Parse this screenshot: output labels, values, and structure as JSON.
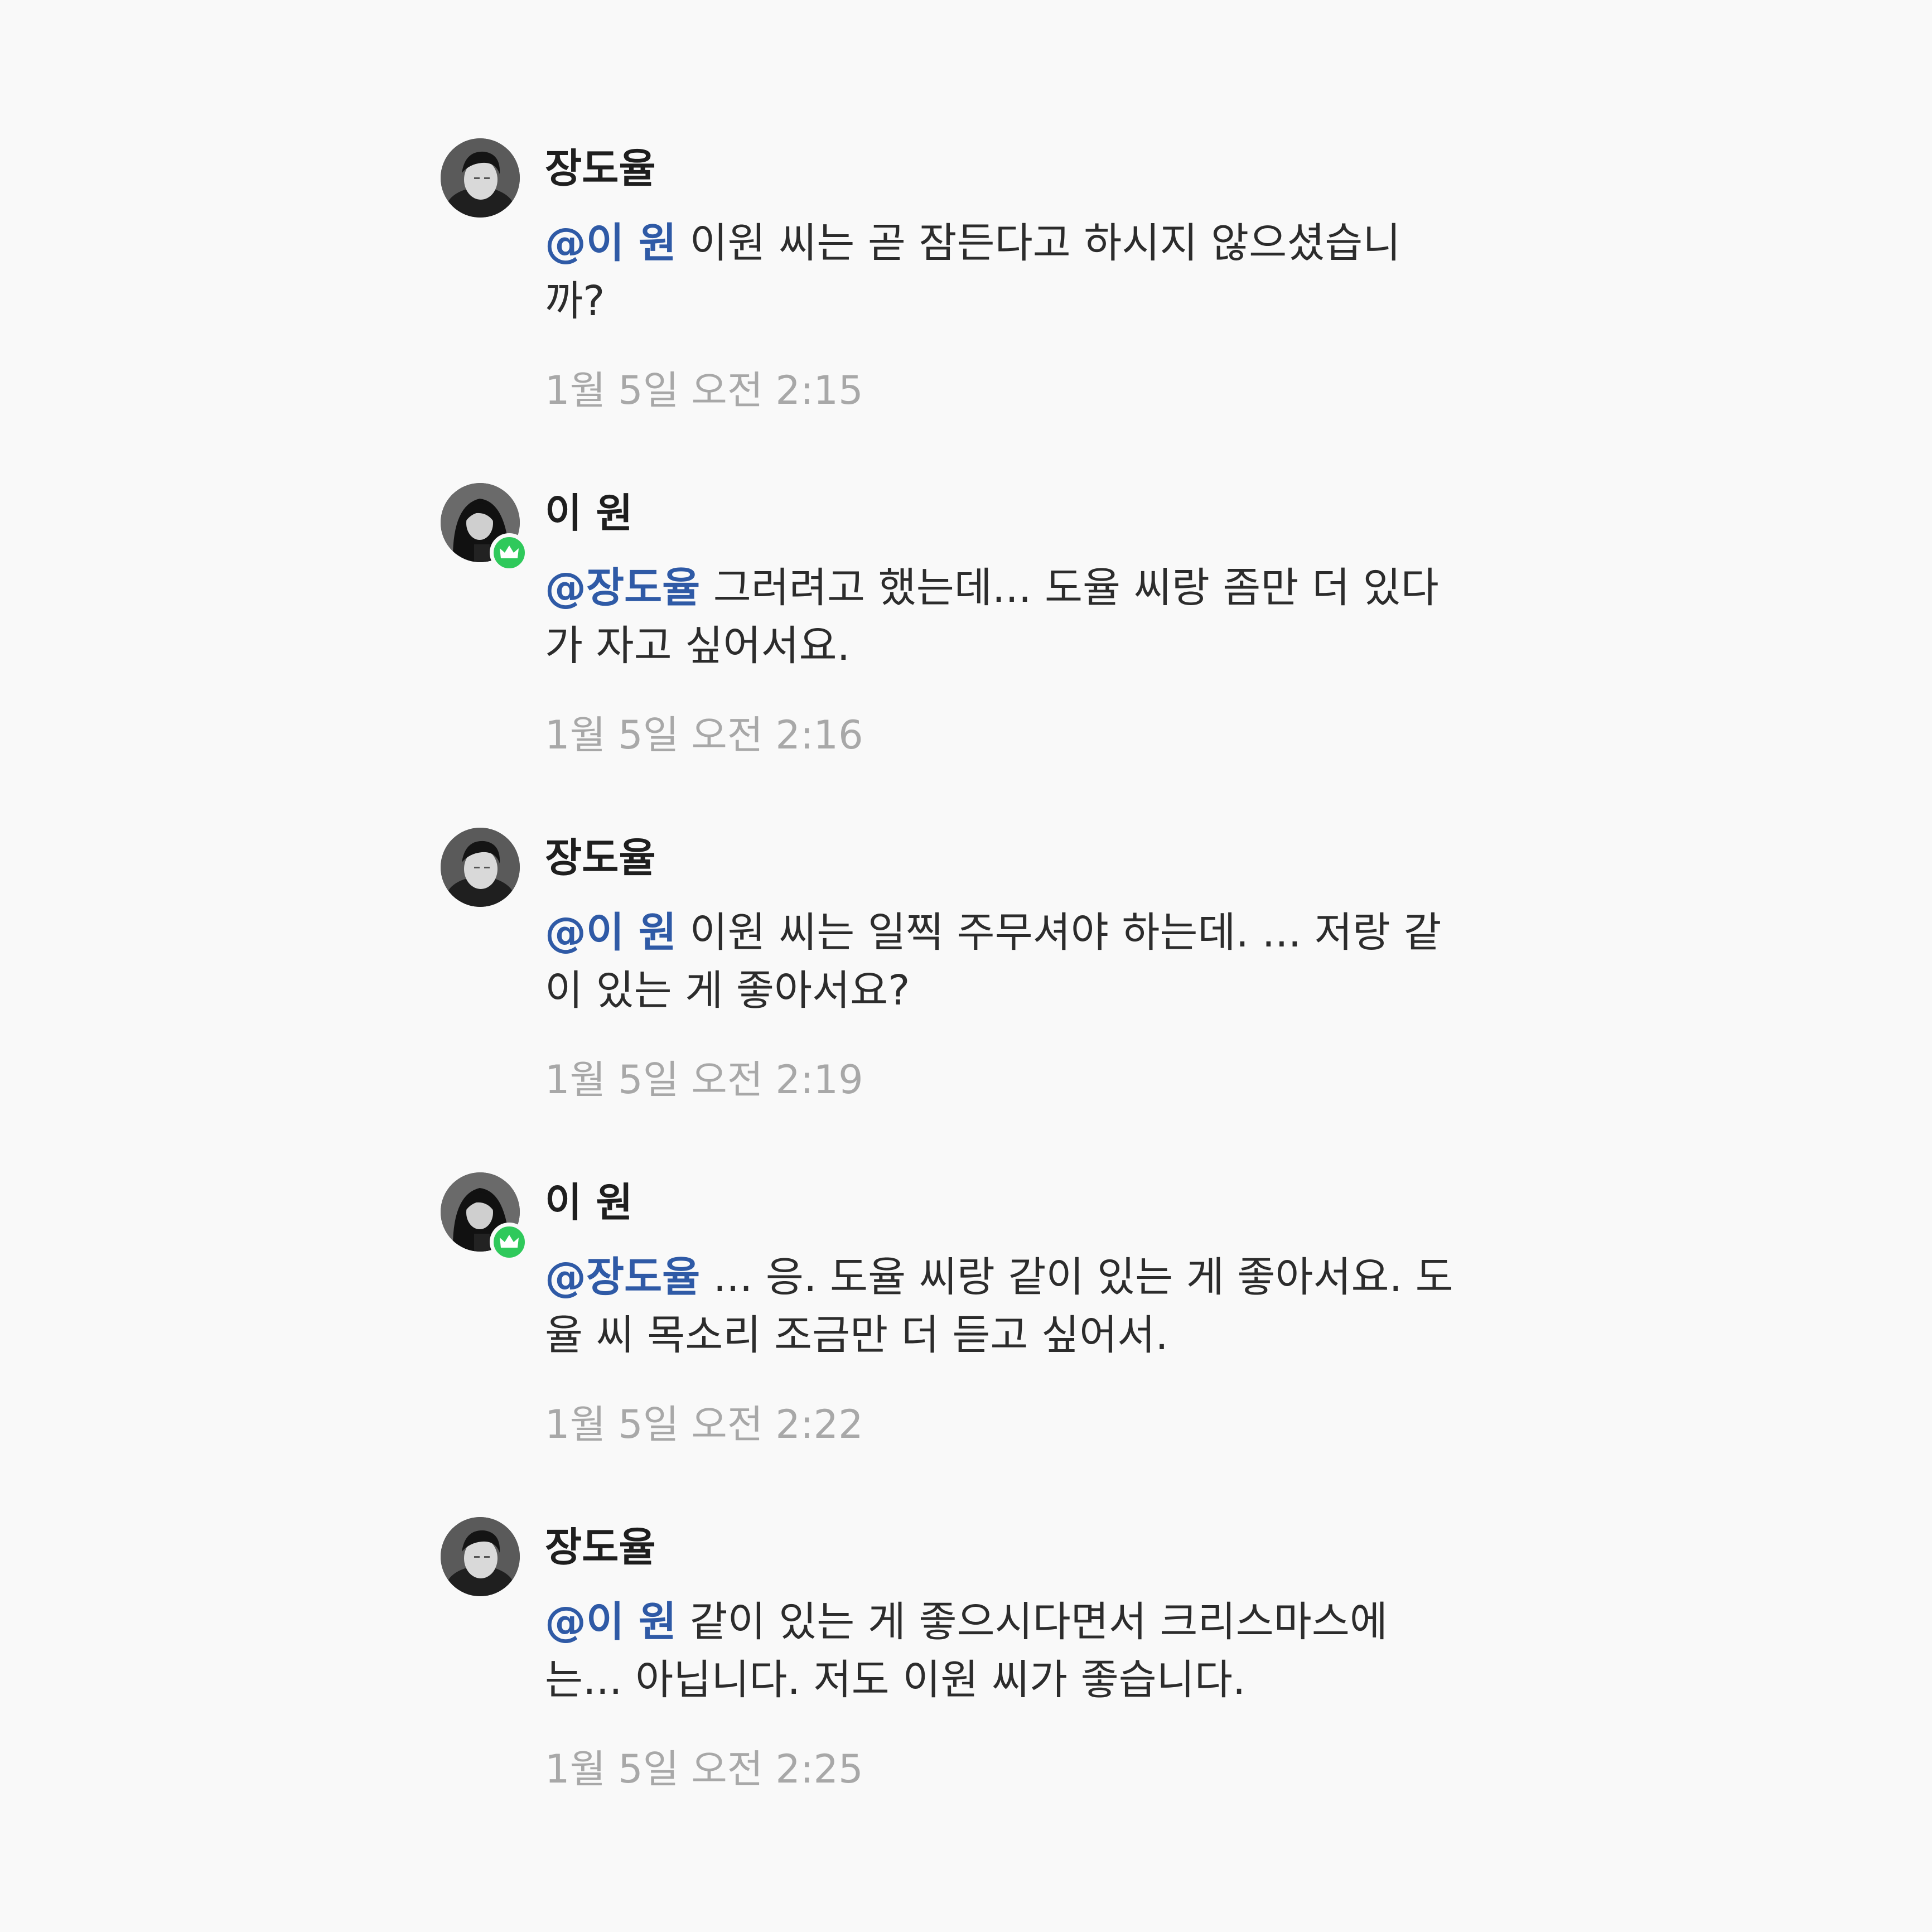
{
  "comments": [
    {
      "author": "장도율",
      "avatar": "man-portrait-avatar",
      "crown": false,
      "mention": "@이 원",
      "text": " 이원 씨는 곧 잠든다고 하시지 않으셨습니까?",
      "time": "1월 5일 오전 2:15"
    },
    {
      "author": "이 원",
      "avatar": "woman-portrait-avatar",
      "crown": true,
      "mention": "@장도율",
      "text": " 그러려고 했는데... 도율 씨랑 좀만 더 있다가 자고 싶어서요.",
      "time": "1월 5일 오전 2:16"
    },
    {
      "author": "장도율",
      "avatar": "man-portrait-avatar",
      "crown": false,
      "mention": "@이 원",
      "text": " 이원 씨는 일찍 주무셔야 하는데. ... 저랑 같이 있는 게 좋아서요?",
      "time": "1월 5일 오전 2:19"
    },
    {
      "author": "이 원",
      "avatar": "woman-portrait-avatar",
      "crown": true,
      "mention": "@장도율",
      "text": " ... 응. 도율 씨랑 같이 있는 게 좋아서요. 도율 씨 목소리 조금만 더 듣고 싶어서.",
      "time": "1월 5일 오전 2:22"
    },
    {
      "author": "장도율",
      "avatar": "man-portrait-avatar",
      "crown": false,
      "mention": "@이 원",
      "text": " 같이 있는 게 좋으시다면서 크리스마스에는... 아닙니다. 저도 이원 씨가 좋습니다.",
      "time": "1월 5일 오전 2:25"
    }
  ],
  "colors": {
    "background": "#f9f9f9",
    "mention": "#2f5aa6",
    "author": "#1e1e1e",
    "body": "#2c2c2c",
    "timestamp": "#a8a8a8",
    "crown_badge": "#2fc95b"
  }
}
